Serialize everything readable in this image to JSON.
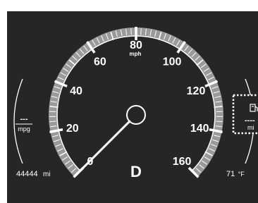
{
  "speedometer": {
    "major_labels": [
      "0",
      "20",
      "40",
      "60",
      "80",
      "100",
      "120",
      "140",
      "160"
    ],
    "unit": "mph",
    "current_speed": 0,
    "max_speed": 160
  },
  "gear": {
    "value": "D"
  },
  "fuel_economy": {
    "value": "---",
    "unit": "mpg"
  },
  "odometer": {
    "value": "44444",
    "unit": "mi"
  },
  "temperature": {
    "value": "71",
    "unit": "°F"
  },
  "trip_panel": {
    "icon": "fuel-pump-icon",
    "value": "----",
    "unit": "mi"
  },
  "colors": {
    "background": "#262626",
    "text": "#ffffff",
    "gauge_ring": "#9a9a9a"
  }
}
